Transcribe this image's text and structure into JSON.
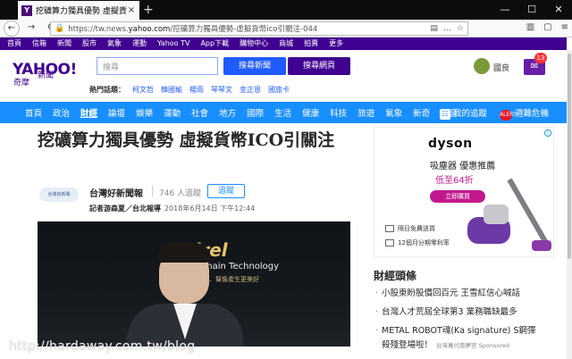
{
  "browser": {
    "tab_title": "挖礦算力獨具優勢 虛擬貨幣ICO引",
    "tab_icon": "Y",
    "url_prefix": "https://tw.news.",
    "url_domain": "yahoo.com",
    "url_rest": "/挖礦算力獨具優勢-虛擬貨幣ico引關注-044",
    "window_controls": [
      "—",
      "☐",
      "✕"
    ]
  },
  "topnav": {
    "items": [
      "首頁",
      "信箱",
      "新聞",
      "股市",
      "氣象",
      "運動",
      "Yahoo TV",
      "App下載",
      "購物中心",
      "商城",
      "拍賣",
      "更多"
    ]
  },
  "header": {
    "logo": "YAHOO!",
    "logo_cn": "奇摩",
    "logo_section": "新聞",
    "search_placeholder": "搜尋",
    "search_news_button": "搜尋新聞",
    "search_web_button": "搜尋網頁",
    "username": "國良",
    "mail_count": "13",
    "hot_label": "熱門話題：",
    "hot_keywords": [
      "柯文哲",
      "韓國瑜",
      "楊雨",
      "琴琴文",
      "金正恩",
      "國旅卡"
    ]
  },
  "catnav": {
    "items": [
      "首頁",
      "政治",
      "財經",
      "論壇",
      "娛樂",
      "運動",
      "社會",
      "地方",
      "國際",
      "生活",
      "健康",
      "科技",
      "旅遊",
      "氣象",
      "新奇",
      "影音"
    ],
    "active": "財經",
    "my_follow": "我的追蹤",
    "alert": "避難危機",
    "alert_badge": "ALERT"
  },
  "article": {
    "headline": "挖礦算力獨具優勢 虛擬貨幣ICO引關注",
    "publisher_logo": "台灣好新聞",
    "publisher": "台灣好新聞報",
    "followers": "746 人追蹤",
    "follow_button": "追蹤",
    "reporter": "記者游森夏／台北報導",
    "timestamp": "2018年6月14日 下午12:44",
    "photo_brand": "Kirel",
    "photo_tagline": "kchain Technology",
    "photo_tagline2": "能源、幫像產生更美好"
  },
  "ad": {
    "brand": "dyson",
    "line1": "吸塵器 優惠推薦",
    "line2": "低至64折",
    "cta": "立即購買",
    "feature1": "隔日免費送貨",
    "feature2": "12個月分期零利率"
  },
  "sidebar": {
    "title": "財經頭條",
    "items": [
      {
        "text": "小股東盼股價回百元 王雪紅信心喊話",
        "sponsor": ""
      },
      {
        "text": "台灣人才荒屆全球第3 業務職缺最多",
        "sponsor": ""
      },
      {
        "text": "METAL ROBOT魂(Ka signature) S鋼彈",
        "sponsor": ""
      },
      {
        "text": "殺殘登場啦！",
        "sponsor": "台灣萬代南夢宮 Sponsored"
      }
    ]
  },
  "watermark": "http://hardaway.com.tw/blog"
}
